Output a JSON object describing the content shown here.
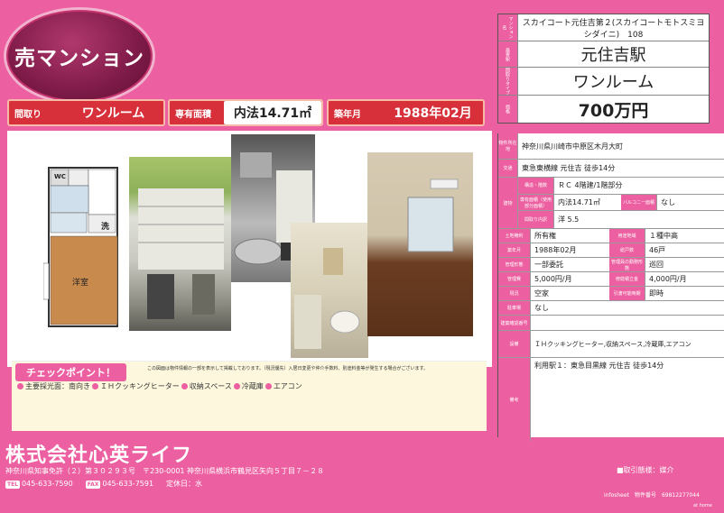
{
  "sale_type": "売マンション",
  "pills": {
    "madori_label": "間取り",
    "madori_value": "ワンルーム",
    "area_label": "専有面積",
    "area_value": "内法14.71㎡",
    "built_label": "築年月",
    "built_value": "1988年02月"
  },
  "summary": {
    "name_label": "マンション名",
    "name_value": "スカイコート元住吉第２(スカイコートモトスミヨシダイニ)　108",
    "station_label": "最寄駅",
    "station_value": "元住吉駅",
    "type_label": "間取りタイプ",
    "type_value": "ワンルーム",
    "price_label": "価格",
    "price_value": "700万円"
  },
  "floorplan": {
    "wc": "WC",
    "room_label": "洋室",
    "sink_label": "洗"
  },
  "check": {
    "title": "チェックポイント！",
    "note": "この図面は物件情報の一部を表示して掲載しております。（現況優先）入居日変更や仲介手数料、別途料金等が発生する場合がございます。",
    "items": [
      "主要採光面：南向き",
      "ＩＨクッキングヒーター",
      "収納スペース",
      "冷蔵庫",
      "エアコン"
    ]
  },
  "details": {
    "address_label": "物件所在地",
    "address": "神奈川県川崎市中原区木月大町",
    "transport_label": "交通",
    "transport": "東急東横線 元住吉 徒歩14分",
    "building_label": "建物",
    "structure_label": "構造・階数",
    "structure": "ＲＣ 4階建/1階部分",
    "area_label": "専有面積（使用部分面積）",
    "area": "内法14.71㎡",
    "balcony_label": "バルコニー面積",
    "balcony": "なし",
    "layout_label": "間取り内訳",
    "layout": "洋 5.5",
    "land_label": "土地権利",
    "land": "所有権",
    "zoning_label": "用途地域",
    "zoning": "１種中高",
    "built_label": "築年月",
    "built": "1988年02月",
    "units_label": "総戸数",
    "units": "46戸",
    "mgmt_label": "管理形態",
    "mgmt": "一部委託",
    "mgmt_staff_label": "管理員の勤務形態",
    "mgmt_staff": "巡回",
    "fee_label": "管理費",
    "fee": "5,000円/月",
    "repair_label": "修繕積立金",
    "repair": "4,000円/月",
    "status_label": "現況",
    "status": "空家",
    "handover_label": "引渡可能時期",
    "handover": "即時",
    "parking_label": "駐車場",
    "parking": "なし",
    "cert_label": "建築確認番号",
    "cert": "",
    "equipment_label": "設備",
    "equipment": "ＩＨクッキングヒーター,収納スペース,冷蔵庫,エアコン",
    "remarks_label": "備考",
    "remarks": "利用駅１：東急目黒線 元住吉 徒歩14分"
  },
  "footer": {
    "company": "株式会社心英ライフ",
    "license": "神奈川県知事免許（２）第３０２９３号　〒230-0001 神奈川県横浜市鶴見区矢向５丁目７－２８",
    "tel_tag": "TEL",
    "tel": "045-633-7590",
    "fax_tag": "FAX",
    "fax": "045-633-7591",
    "holiday": "定休日：水",
    "broker": "■取引態様：媒介",
    "sheet_label": "infosheet",
    "sheet_number": "物件番号　69812277044",
    "athome": "at home"
  },
  "colors": {
    "brand_pink": "#ec5fa0",
    "pill_red": "#d7303a",
    "badge_dark": "#7d1a47"
  }
}
